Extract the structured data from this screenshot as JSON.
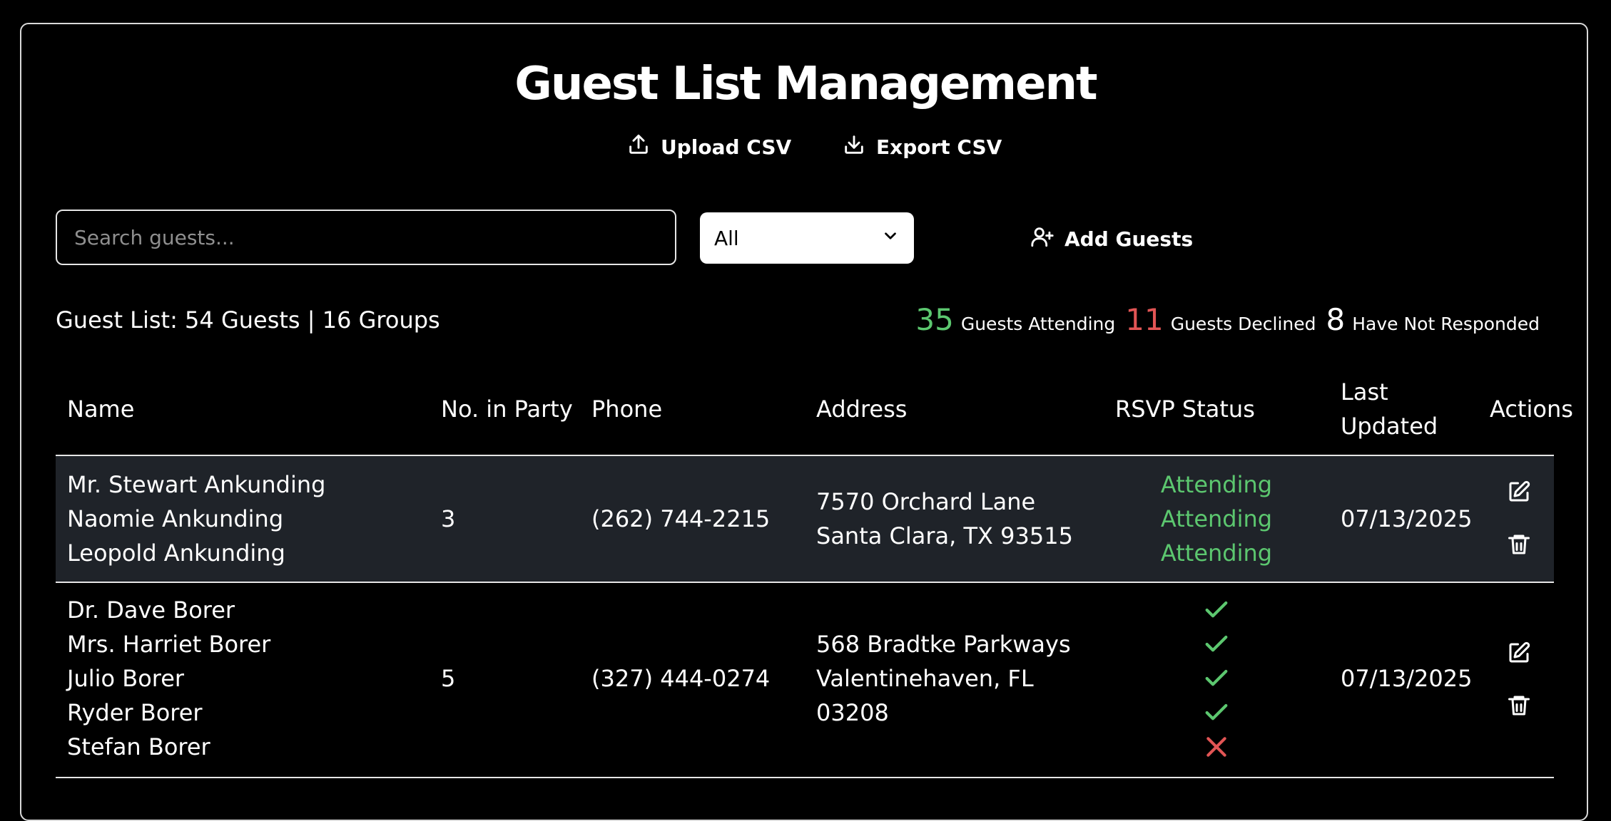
{
  "page": {
    "title": "Guest List Management"
  },
  "toolbar": {
    "upload_label": "Upload CSV",
    "export_label": "Export CSV",
    "add_guests_label": "Add Guests"
  },
  "search": {
    "placeholder": "Search guests...",
    "value": ""
  },
  "filter": {
    "selected": "All"
  },
  "summary": {
    "text": "Guest List: 54 Guests | 16 Groups"
  },
  "stats": {
    "attending_count": "35",
    "attending_label": "Guests Attending",
    "declined_count": "11",
    "declined_label": "Guests Declined",
    "pending_count": "8",
    "pending_label": "Have Not Responded"
  },
  "table": {
    "headers": {
      "name": "Name",
      "party": "No. in Party",
      "phone": "Phone",
      "address": "Address",
      "rsvp": "RSVP Status",
      "updated_line1": "Last",
      "updated_line2": "Updated",
      "actions": "Actions"
    },
    "rows": [
      {
        "names": [
          "Mr. Stewart Ankunding",
          "Naomie Ankunding",
          "Leopold Ankunding"
        ],
        "party": "3",
        "phone": "(262) 744-2215",
        "address": [
          "7570 Orchard Lane",
          "Santa Clara, TX 93515"
        ],
        "rsvp": [
          "Attending",
          "Attending",
          "Attending"
        ],
        "updated": "07/13/2025"
      },
      {
        "names": [
          "Dr. Dave Borer",
          "Mrs. Harriet Borer",
          "Julio Borer",
          "Ryder Borer",
          "Stefan Borer"
        ],
        "party": "5",
        "phone": "(327) 444-0274",
        "address": [
          "568 Bradtke Parkways",
          "Valentinehaven, FL",
          "03208"
        ],
        "rsvp_icons": [
          "check-icon",
          "check-icon",
          "check-icon",
          "check-icon",
          "x-icon"
        ],
        "updated": "07/13/2025"
      }
    ]
  },
  "colors": {
    "attending": "#5cc76f",
    "declined": "#e25555",
    "row_highlight": "#1f2329"
  }
}
